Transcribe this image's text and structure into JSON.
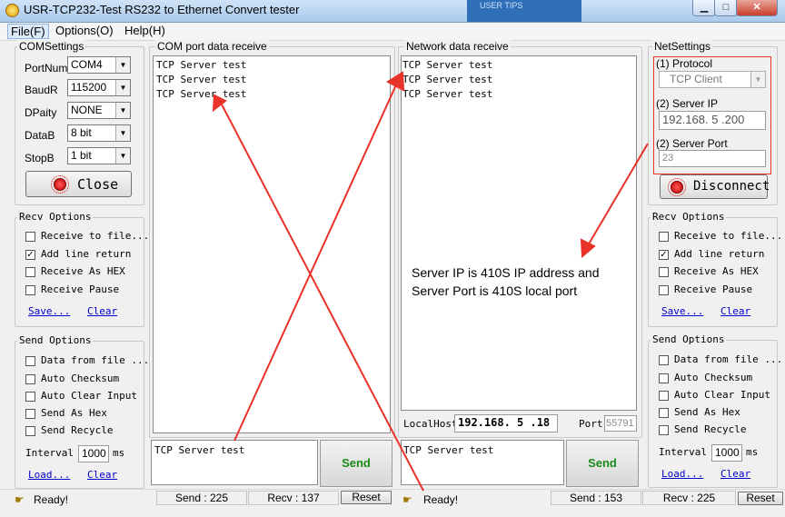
{
  "window": {
    "title": "USR-TCP232-Test  RS232 to Ethernet Convert tester",
    "minimize": "▁",
    "maximize": "□",
    "close": "✕",
    "overlay_text": "USER TIPS"
  },
  "menu": [
    "File(F)",
    "Options(O)",
    "Help(H)"
  ],
  "com_settings": {
    "title": "COMSettings",
    "fields": [
      {
        "label": "PortNum",
        "value": "COM4"
      },
      {
        "label": "BaudR",
        "value": "115200"
      },
      {
        "label": "DPaity",
        "value": "NONE"
      },
      {
        "label": "DataB",
        "value": "8 bit"
      },
      {
        "label": "StopB",
        "value": "1 bit"
      }
    ],
    "close_button": "Close"
  },
  "left_recv": {
    "title": "Recv Options",
    "options": [
      {
        "label": "Receive to file...",
        "checked": false
      },
      {
        "label": "Add line return",
        "checked": true
      },
      {
        "label": "Receive As HEX",
        "checked": false
      },
      {
        "label": "Receive Pause",
        "checked": false
      }
    ],
    "save": "Save...",
    "clear": "Clear"
  },
  "left_send": {
    "title": "Send Options",
    "options": [
      {
        "label": "Data from file ...",
        "checked": false
      },
      {
        "label": "Auto Checksum",
        "checked": false
      },
      {
        "label": "Auto Clear Input",
        "checked": false
      },
      {
        "label": "Send As Hex",
        "checked": false
      },
      {
        "label": "Send Recycle",
        "checked": false
      }
    ],
    "interval_label": "Interval",
    "interval_value": "1000",
    "interval_unit": "ms",
    "load": "Load...",
    "clear": "Clear"
  },
  "com_receive": {
    "title": "COM port data receive",
    "lines": [
      "TCP Server test",
      "TCP Server test",
      "TCP Server test"
    ],
    "input": "TCP Server test",
    "send": "Send"
  },
  "net_receive": {
    "title": "Network data receive",
    "lines": [
      "TCP Server test",
      "TCP Server test",
      "TCP Server test"
    ],
    "annotation_line1": "Server IP is 410S IP address and",
    "annotation_line2": "Server Port is 410S local port",
    "localhost_label": "LocalHost",
    "localhost_value": "192.168. 5 .18",
    "port_label": "Port",
    "port_value": "55791",
    "input": "TCP Server test",
    "send": "Send"
  },
  "net_settings": {
    "title": "NetSettings",
    "protocol_label": "(1) Protocol",
    "protocol_value": "TCP Client",
    "server_ip_label": "(2) Server IP",
    "server_ip_value": "192.168. 5 .200",
    "server_port_label": "(2) Server Port",
    "server_port_value": "23",
    "disconnect": "Disconnect"
  },
  "right_recv": {
    "title": "Recv Options",
    "options": [
      {
        "label": "Receive to file...",
        "checked": false
      },
      {
        "label": "Add line return",
        "checked": true
      },
      {
        "label": "Receive As HEX",
        "checked": false
      },
      {
        "label": "Receive Pause",
        "checked": false
      }
    ],
    "save": "Save...",
    "clear": "Clear"
  },
  "right_send": {
    "title": "Send Options",
    "options": [
      {
        "label": "Data from file ...",
        "checked": false
      },
      {
        "label": "Auto Checksum",
        "checked": false
      },
      {
        "label": "Auto Clear Input",
        "checked": false
      },
      {
        "label": "Send As Hex",
        "checked": false
      },
      {
        "label": "Send Recycle",
        "checked": false
      }
    ],
    "interval_label": "Interval",
    "interval_value": "1000",
    "interval_unit": "ms",
    "load": "Load...",
    "clear": "Clear"
  },
  "status_left": {
    "ready": "Ready!",
    "send": "Send : 225",
    "recv": "Recv : 137",
    "reset": "Reset"
  },
  "status_right": {
    "ready": "Ready!",
    "send": "Send : 153",
    "recv": "Recv : 225",
    "reset": "Reset"
  },
  "colors": {
    "annotation_red": "#e8322a",
    "send_green": "#1a8a1a",
    "link_blue": "#0000cc"
  }
}
